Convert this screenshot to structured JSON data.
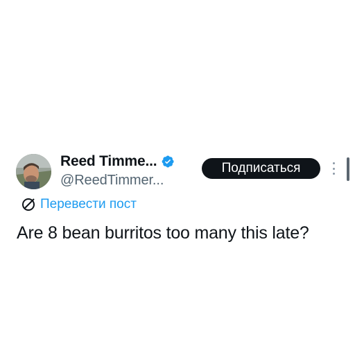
{
  "author": {
    "display_name": "Reed Timme...",
    "handle": "@ReedTimmer...",
    "verified": true
  },
  "actions": {
    "follow_label": "Подписаться"
  },
  "translate": {
    "label": "Перевести пост"
  },
  "post": {
    "text": "Are 8 bean burritos too many this late?"
  },
  "icons": {
    "verified": "verified-badge-icon",
    "translate": "globe-translate-icon",
    "more": "more-vertical-icon"
  },
  "colors": {
    "accent": "#1d9bf0",
    "text": "#0f1419",
    "secondary_text": "#536471",
    "follow_button_bg": "#0f1419",
    "follow_button_text": "#ffffff"
  }
}
